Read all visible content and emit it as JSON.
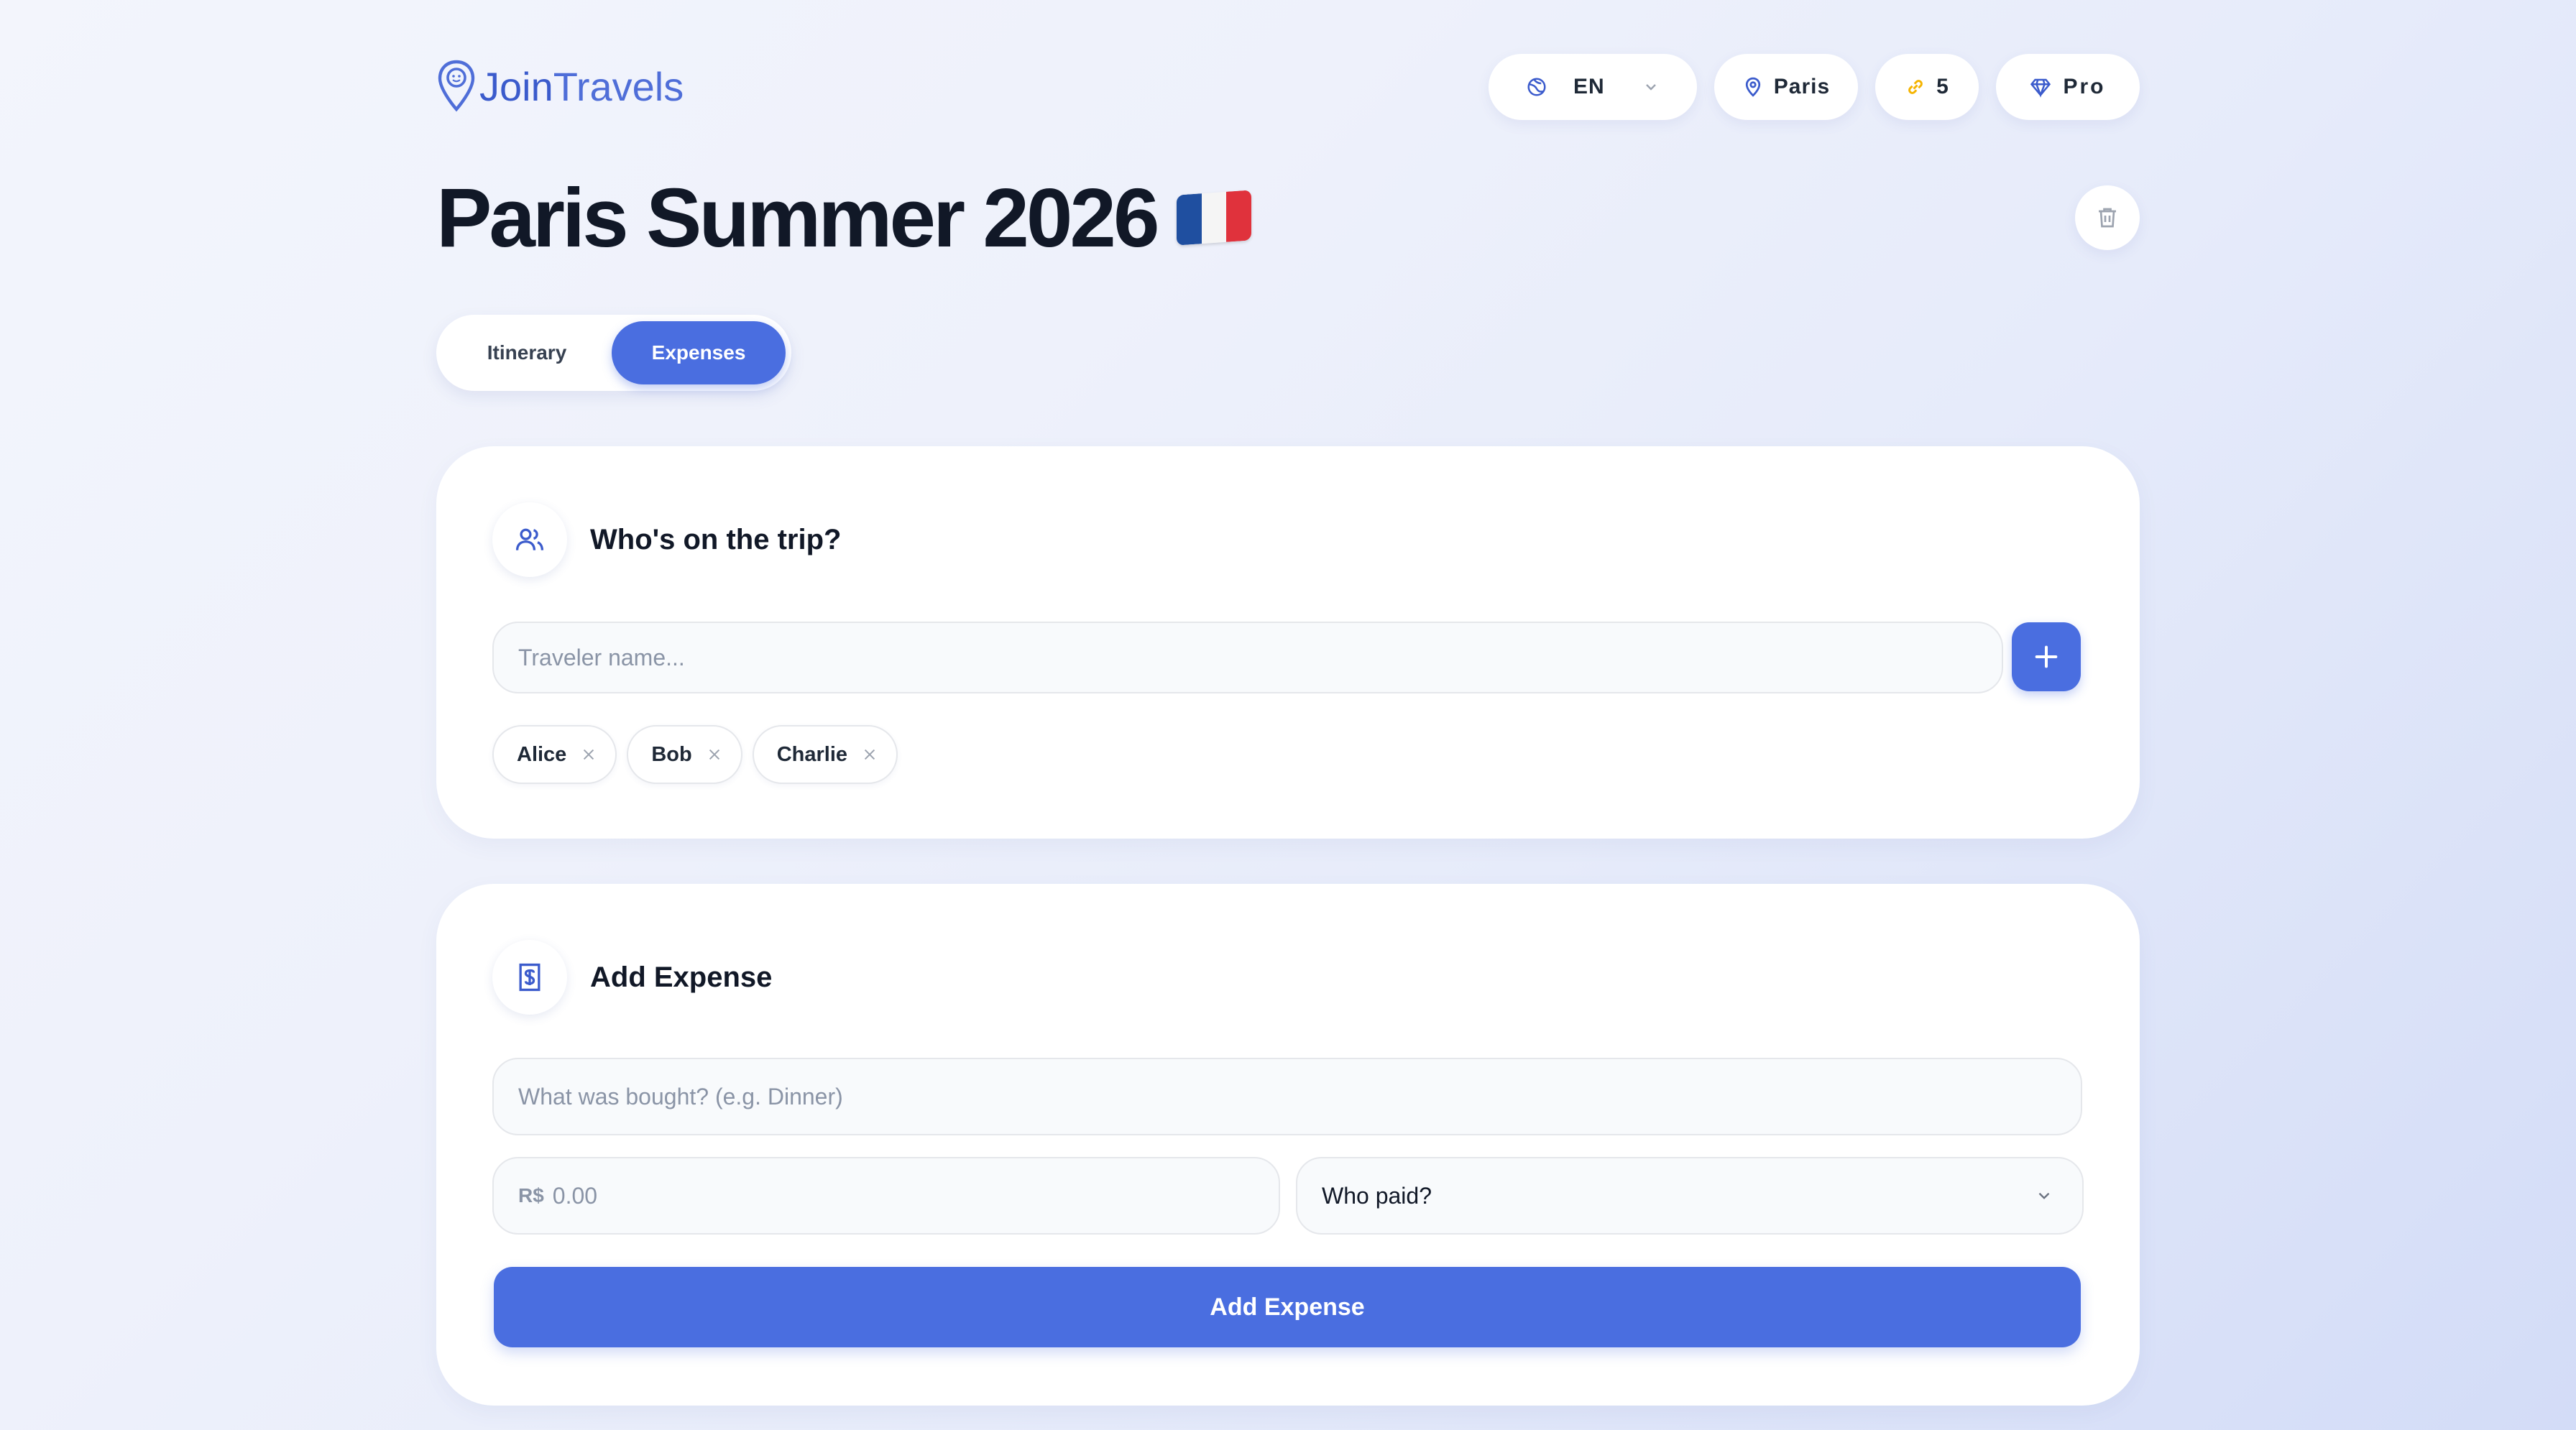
{
  "app": {
    "logo_text_part1": "Join",
    "logo_text_part2": "Travels"
  },
  "header": {
    "language": "EN",
    "city": "Paris",
    "count": "5",
    "plan": "Pro"
  },
  "page": {
    "title": "Paris Summer 2026"
  },
  "tabs": [
    {
      "label": "Itinerary",
      "active": false
    },
    {
      "label": "Expenses",
      "active": true
    }
  ],
  "travelers_card": {
    "title": "Who's on the trip?",
    "input_placeholder": "Traveler name...",
    "travelers": [
      "Alice",
      "Bob",
      "Charlie"
    ]
  },
  "expense_card": {
    "title": "Add Expense",
    "what_placeholder": "What was bought? (e.g. Dinner)",
    "currency": "R$",
    "amount_placeholder": "0.00",
    "payer_placeholder": "Who paid?",
    "submit_label": "Add Expense"
  },
  "colors": {
    "accent": "#4a6ee0",
    "logo": "#3b5bcc",
    "coin": "#f5b400"
  },
  "icons": {
    "language": "globe-icon",
    "city": "map-pin-icon",
    "count": "link-icon",
    "plan": "diamond-icon",
    "delete": "trash-icon",
    "travelers": "users-icon",
    "expense": "receipt-icon"
  }
}
